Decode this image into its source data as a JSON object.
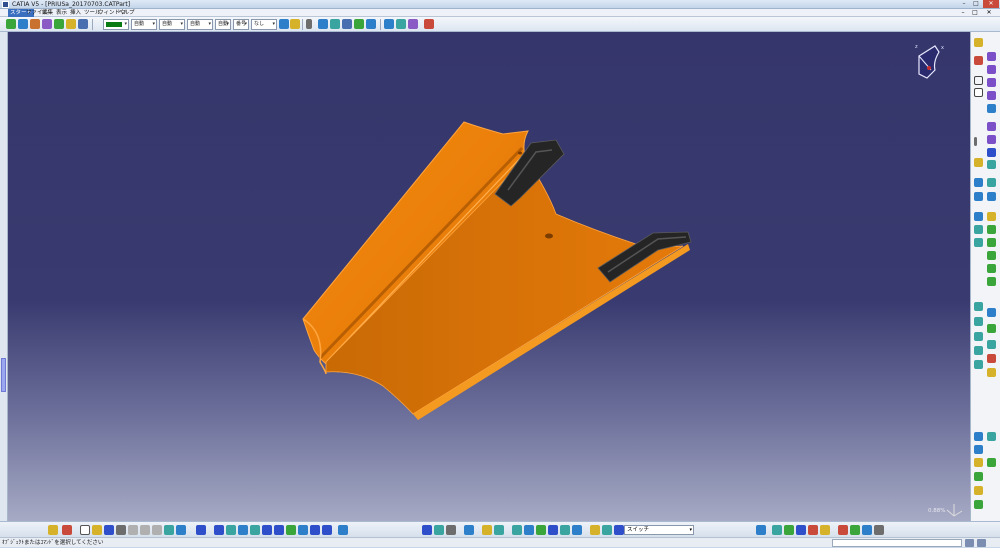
{
  "window": {
    "title": "CATIA V5 - [PRIUSa_20170703.CATPart]",
    "minimize_glyph": "–",
    "maximize_glyph": "□",
    "close_glyph": "✕"
  },
  "menu": {
    "items": [
      {
        "label": "スタート",
        "active": true
      },
      {
        "label": "ファイル"
      },
      {
        "label": "編集"
      },
      {
        "label": "表示"
      },
      {
        "label": "挿入"
      },
      {
        "label": "ツール"
      },
      {
        "label": "ウィンドウ"
      },
      {
        "label": "ヘルプ"
      }
    ]
  },
  "toolbar": {
    "color_combo": {
      "color": "#0a7a12"
    },
    "combo_1": "自動",
    "combo_2": "自動",
    "combo_3": "自動",
    "combo_4": "自動",
    "combo_5": "番号",
    "combo_6": "なし"
  },
  "bottom_toolbar": {
    "switch_combo": "スイッチ"
  },
  "viewport": {
    "zoom_readout": "0.88%",
    "part_color": "#f08000",
    "clip_color": "#262626",
    "background_top": "#35366b",
    "background_bottom": "#a6aac4"
  },
  "status": {
    "message": "ｵﾌﾞｼﾞｪｸﾄまたはｺﾏﾝﾄﾞを選択してください"
  },
  "icons": {
    "app": "catia-app-icon",
    "compass": "compass-icon",
    "axis": "axis-gizmo-icon"
  }
}
